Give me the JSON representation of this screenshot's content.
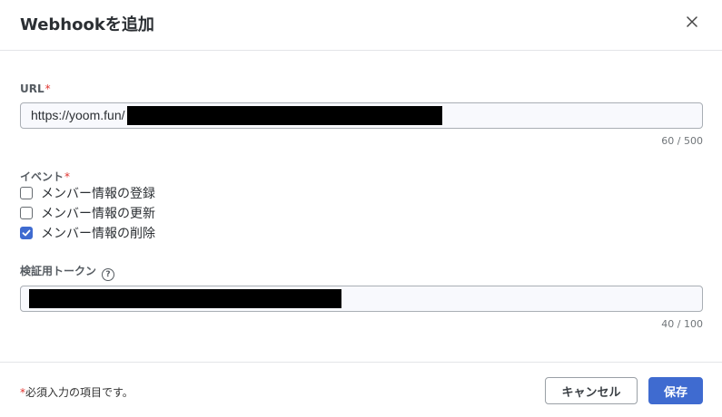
{
  "dialog": {
    "title": "Webhookを追加",
    "close_icon": "close-icon"
  },
  "url_field": {
    "label": "URL",
    "required_mark": "*",
    "value": "https://yoom.fun/",
    "counter": "60 / 500"
  },
  "event_field": {
    "label": "イベント",
    "required_mark": "*",
    "options": [
      {
        "label": "メンバー情報の登録",
        "checked": false
      },
      {
        "label": "メンバー情報の更新",
        "checked": false
      },
      {
        "label": "メンバー情報の削除",
        "checked": true
      }
    ]
  },
  "token_field": {
    "label": "検証用トークン",
    "help_icon": "help-circle-icon",
    "help_glyph": "?",
    "value": "",
    "counter": "40 / 100"
  },
  "footer": {
    "required_mark": "*",
    "required_note": "必須入力の項目です。",
    "cancel_label": "キャンセル",
    "save_label": "保存"
  },
  "colors": {
    "accent": "#3f6bd0",
    "required": "#e0342f",
    "redaction": "#000000"
  }
}
